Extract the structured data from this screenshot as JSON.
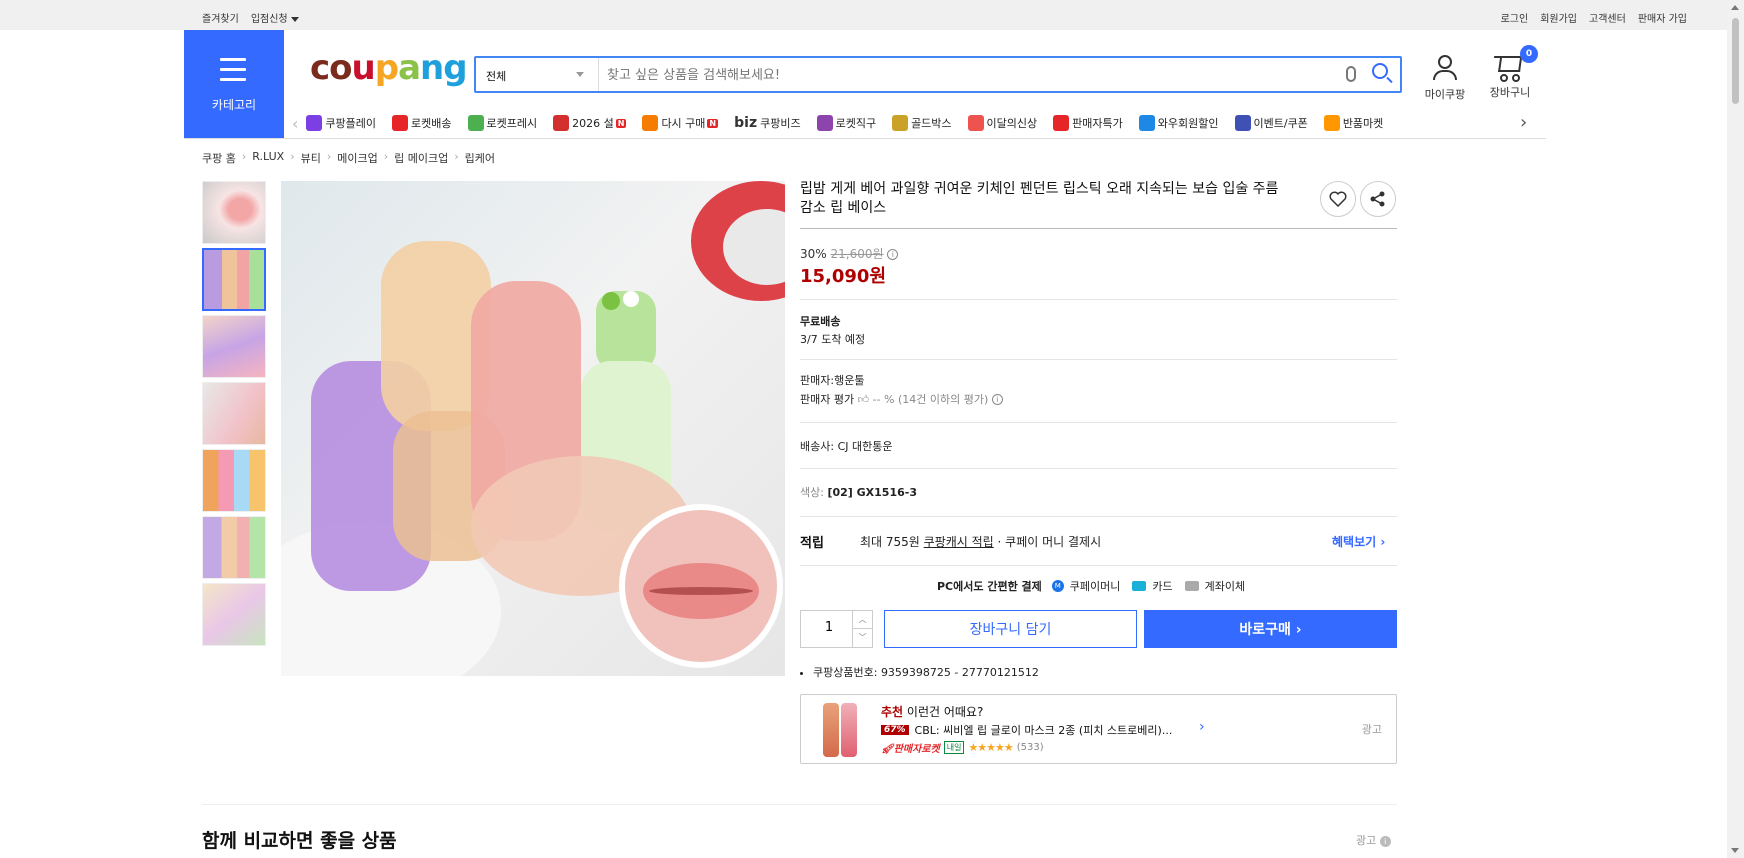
{
  "topbar": {
    "left": [
      "즐겨찾기",
      "입점신청"
    ],
    "right": [
      "로그인",
      "회원가입",
      "고객센터",
      "판매자 가입"
    ]
  },
  "header": {
    "category_label": "카테고리",
    "logo_parts": [
      "co",
      "u",
      "p",
      "a",
      "ng"
    ],
    "search": {
      "category": "전체",
      "placeholder": "찾고 싶은 상품을 검색해보세요!"
    },
    "mycoupang": "마이쿠팡",
    "cart_label": "장바구니",
    "cart_count": "0"
  },
  "nav": {
    "items": [
      {
        "label": "쿠팡플레이",
        "icon": "play-icon",
        "color": "#7b3fe4"
      },
      {
        "label": "로켓배송",
        "icon": "rocket-icon",
        "color": "#e52528"
      },
      {
        "label": "로켓프레시",
        "icon": "rocket-fresh-icon",
        "color": "#4caf50"
      },
      {
        "label": "2026 설",
        "icon": "gift-icon",
        "color": "#d32f2f",
        "badge": "N"
      },
      {
        "label": "다시 구매",
        "icon": "home-icon",
        "color": "#f57c00",
        "badge": "N"
      },
      {
        "label": "쿠팡비즈",
        "icon": "biz-icon",
        "color": "#333",
        "prefix": "biz"
      },
      {
        "label": "로켓직구",
        "icon": "global-rocket-icon",
        "color": "#8e44ad"
      },
      {
        "label": "골드박스",
        "icon": "goldbox-icon",
        "color": "#c9a227"
      },
      {
        "label": "이달의신상",
        "icon": "new-bag-icon",
        "color": "#ef5350"
      },
      {
        "label": "판매자특가",
        "icon": "percent-icon",
        "color": "#e52528"
      },
      {
        "label": "와우회원할인",
        "icon": "wow-icon",
        "color": "#1e88e5"
      },
      {
        "label": "이벤트/쿠폰",
        "icon": "coupon-icon",
        "color": "#3f51b5"
      },
      {
        "label": "반품마켓",
        "icon": "market-icon",
        "color": "#ff9800"
      }
    ]
  },
  "breadcrumb": [
    "쿠팡 홈",
    "R.LUX",
    "뷰티",
    "메이크업",
    "립 메이크업",
    "립케어"
  ],
  "product": {
    "title": "립밤 게게 베어 과일향 귀여운 키체인 펜던트 립스틱 오래 지속되는 보습 입술 주름 감소 립 베이스",
    "discount": "30%",
    "original_price": "21,600원",
    "price": "15,090원",
    "shipping_title": "무료배송",
    "arrival": "3/7 도착 예정",
    "seller_label": "판매자:",
    "seller": "행운툴",
    "seller_rating_label": "판매자 평가",
    "seller_rating": "-- % (14건 이하의 평가)",
    "carrier_label": "배송사:",
    "carrier": "CJ 대한통운",
    "color_label": "색상:",
    "color": "[02] GX1516-3",
    "reward_label": "적립",
    "reward_prefix": "최대 755원 ",
    "reward_link": "쿠팡캐시 적립",
    "reward_suffix": " · 쿠페이 머니 결제시",
    "benefit_link": "혜택보기 ›",
    "pay_title": "PC에서도 간편한 결제",
    "pay_methods": [
      "쿠페이머니",
      "카드",
      "계좌이체"
    ],
    "quantity": "1",
    "add_to_cart": "장바구니 담기",
    "buy_now": "바로구매 ›",
    "pid_label": "쿠팡상품번호:",
    "pid": "9359398725 - 27770121512"
  },
  "recommend": {
    "tag": "추천",
    "heading": " 이런건 어때요?",
    "discount": "67%",
    "name": "CBL: 씨비엘 립 글로이 마스크 2종 (피치 스트로베리)...",
    "rocket": "판매자로켓",
    "arrival": "내일",
    "rating": 5,
    "stars": "★★★★★",
    "reviews": "(533)",
    "ad": "광고"
  },
  "section": {
    "compare_title": "함께 비교하면 좋을 상품",
    "ad": "광고"
  }
}
